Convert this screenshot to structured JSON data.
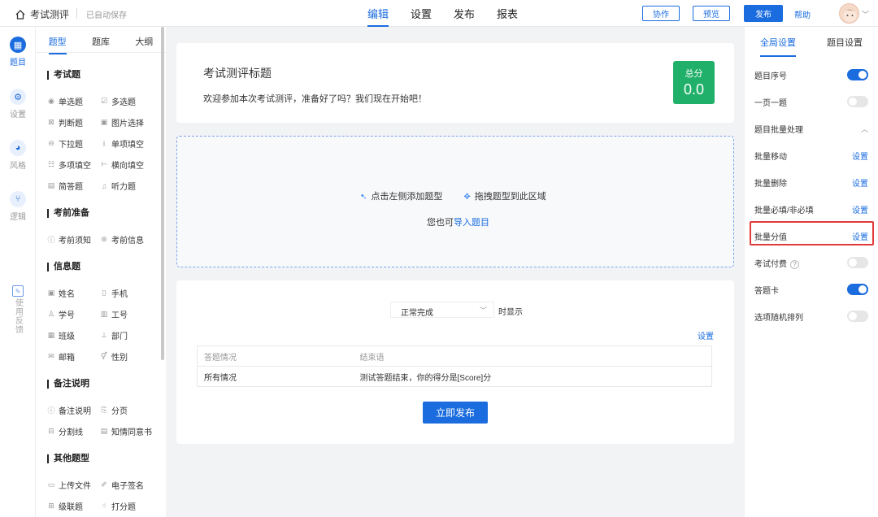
{
  "topbar": {
    "title": "考试测评",
    "autosave": "已自动保存",
    "nav": [
      {
        "label": "编辑"
      },
      {
        "label": "设置"
      },
      {
        "label": "发布"
      },
      {
        "label": "报表"
      }
    ],
    "collab": "协作",
    "preview": "预览",
    "publish": "发布",
    "help": "帮助"
  },
  "rail": [
    {
      "label": "题目",
      "icon": "grid-icon"
    },
    {
      "label": "设置",
      "icon": "gear-icon"
    },
    {
      "label": "风格",
      "icon": "palette-icon"
    },
    {
      "label": "逻辑",
      "icon": "logic-icon"
    }
  ],
  "feedback": "使用反馈",
  "qpanel": {
    "tabs": [
      "题型",
      "题库",
      "大纲"
    ],
    "sections": {
      "exam": "考试题",
      "prep": "考前准备",
      "info": "信息题",
      "note": "备注说明",
      "other": "其他题型"
    },
    "items": {
      "single": "单选题",
      "multi": "多选题",
      "judge": "判断题",
      "image": "图片选择",
      "dropdown": "下拉题",
      "fill": "单项填空",
      "multifill": "多项填空",
      "hfill": "横向填空",
      "short": "简答题",
      "listen": "听力题",
      "notice": "考前须知",
      "examinfo": "考前信息",
      "name": "姓名",
      "phone": "手机",
      "sid": "学号",
      "jobno": "工号",
      "class": "班级",
      "dept": "部门",
      "email": "邮箱",
      "gender": "性别",
      "remark": "备注说明",
      "page": "分页",
      "divider": "分割线",
      "consent": "知情同意书",
      "upload": "上传文件",
      "sign": "电子签名",
      "cascade": "级联题",
      "rate": "打分题"
    }
  },
  "header": {
    "title": "考试测评标题",
    "desc": "欢迎参加本次考试测评，准备好了吗？我们现在开始吧！",
    "score_label": "总分",
    "score_value": "0.0"
  },
  "dropzone": {
    "hint1": "点击左侧添加题型",
    "hint2": "拖拽题型到此区域",
    "import_prefix": "您也可",
    "import_link": "导入题目"
  },
  "end": {
    "select_value": "正常完成",
    "show_when": "时显示",
    "settings": "设置",
    "table_header": [
      "答题情况",
      "结束语"
    ],
    "table_row": [
      "所有情况",
      "测试答题结束，你的得分是[Score]分"
    ],
    "publish_now": "立即发布"
  },
  "rpanel": {
    "tabs": [
      "全局设置",
      "题目设置"
    ],
    "rows": {
      "numbering": "题目序号",
      "onepage": "一页一题",
      "batch": "题目批量处理",
      "move": "批量移动",
      "delete": "批量删除",
      "required": "批量必填/非必填",
      "score": "批量分值",
      "paid": "考试付费",
      "card": "答题卡",
      "random": "选项随机排列"
    },
    "settings_link": "设置",
    "collapse_icon": "chevron-up-icon"
  },
  "colors": {
    "accent": "#1a6cdf",
    "score_bg": "#21b06a",
    "highlight": "#e23a3a"
  }
}
